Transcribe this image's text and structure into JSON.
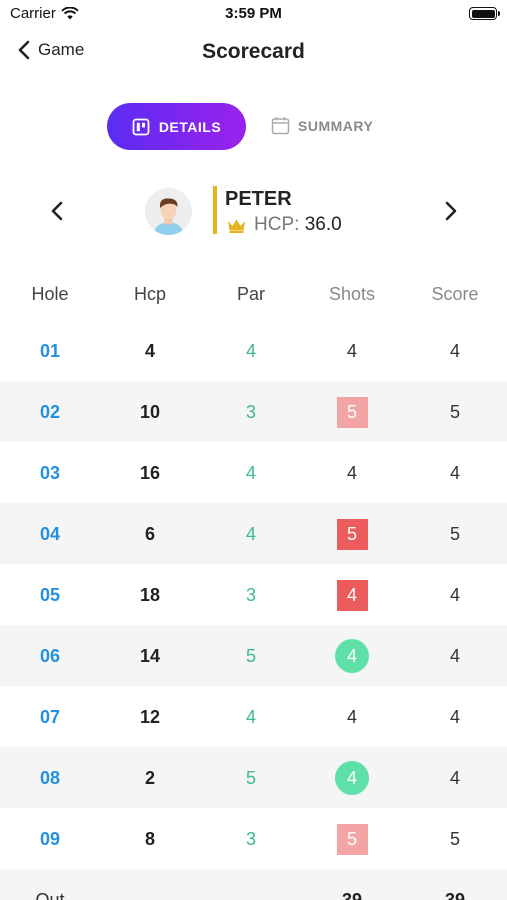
{
  "status": {
    "carrier": "Carrier",
    "time": "3:59 PM"
  },
  "nav": {
    "back_label": "Game",
    "title": "Scorecard"
  },
  "tabs": {
    "details_label": "DETAILS",
    "summary_label": "SUMMARY",
    "active": "details"
  },
  "player": {
    "name": "PETER",
    "hcp_label": "HCP:",
    "hcp_value": "36.0"
  },
  "table": {
    "headers": [
      "Hole",
      "Hcp",
      "Par",
      "Shots",
      "Score"
    ],
    "rows": [
      {
        "hole": "01",
        "hcp": "4",
        "par": "4",
        "shots": "4",
        "score": "4",
        "shots_style": "plain"
      },
      {
        "hole": "02",
        "hcp": "10",
        "par": "3",
        "shots": "5",
        "score": "5",
        "shots_style": "bogey"
      },
      {
        "hole": "03",
        "hcp": "16",
        "par": "4",
        "shots": "4",
        "score": "4",
        "shots_style": "plain"
      },
      {
        "hole": "04",
        "hcp": "6",
        "par": "4",
        "shots": "5",
        "score": "5",
        "shots_style": "double"
      },
      {
        "hole": "05",
        "hcp": "18",
        "par": "3",
        "shots": "4",
        "score": "4",
        "shots_style": "double"
      },
      {
        "hole": "06",
        "hcp": "14",
        "par": "5",
        "shots": "4",
        "score": "4",
        "shots_style": "circle"
      },
      {
        "hole": "07",
        "hcp": "12",
        "par": "4",
        "shots": "4",
        "score": "4",
        "shots_style": "plain"
      },
      {
        "hole": "08",
        "hcp": "2",
        "par": "5",
        "shots": "4",
        "score": "4",
        "shots_style": "circle"
      },
      {
        "hole": "09",
        "hcp": "8",
        "par": "3",
        "shots": "5",
        "score": "5",
        "shots_style": "bogey"
      }
    ],
    "out": {
      "label": "Out",
      "shots": "39",
      "score": "39"
    }
  },
  "colors": {
    "accent_gradient_start": "#5b2cf3",
    "accent_gradient_end": "#9a22ec",
    "hole_blue": "#2490df",
    "par_green": "#3dba8f",
    "bogey_pink": "#f3a5a5",
    "double_red": "#ec5c5c",
    "birdie_green": "#5ee0a8",
    "divider_gold": "#e6b31e"
  },
  "icons": [
    "wifi-icon",
    "battery-icon",
    "back-chevron-icon",
    "details-board-icon",
    "calendar-icon",
    "prev-chevron-icon",
    "next-chevron-icon",
    "crown-icon",
    "avatar"
  ]
}
